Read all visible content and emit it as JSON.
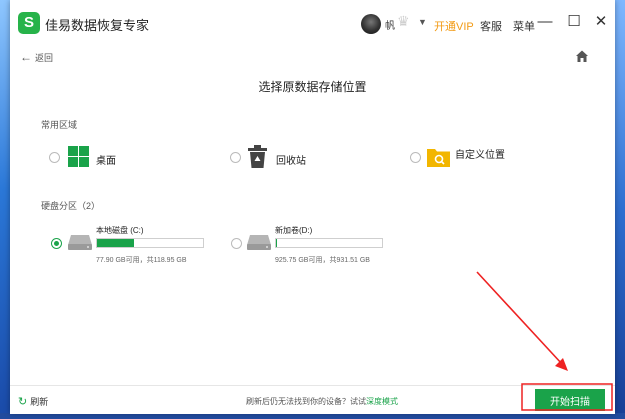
{
  "app": {
    "title": "佳易数据恢复专家",
    "logo_letter": "S",
    "accent": "#1aa34a",
    "vip_color": "#f29b16"
  },
  "header": {
    "username": "帆",
    "vip_link": "开通VIP",
    "service": "客服",
    "menu": "菜单",
    "window_controls": {
      "minimize": "—",
      "maximize": "☐",
      "close": "✕"
    }
  },
  "nav": {
    "back_label": "返回",
    "home_icon": "home-icon"
  },
  "main": {
    "heading": "选择原数据存储位置",
    "common_section": {
      "title": "常用区域",
      "options": [
        {
          "label": "桌面",
          "icon": "windows-icon",
          "selected": false
        },
        {
          "label": "回收站",
          "icon": "recycle-bin-icon",
          "selected": false
        },
        {
          "label": "自定义位置",
          "icon": "folder-search-icon",
          "selected": false
        }
      ]
    },
    "partition_section": {
      "title": "硬盘分区（2）",
      "drives": [
        {
          "name": "本地磁盘 (C:)",
          "size_text": "77.90 GB可用，共118.95 GB",
          "used_fraction": 0.345,
          "selected": true
        },
        {
          "name": "新加卷(D:)",
          "size_text": "925.75 GB可用，共931.51 GB",
          "used_fraction": 0.006,
          "selected": false
        }
      ]
    }
  },
  "footer": {
    "refresh_label": "刷新",
    "hint_text": "刷新后仍无法找到你的设备？试试",
    "deep_mode_link": "深度模式",
    "scan_button": "开始扫描"
  }
}
